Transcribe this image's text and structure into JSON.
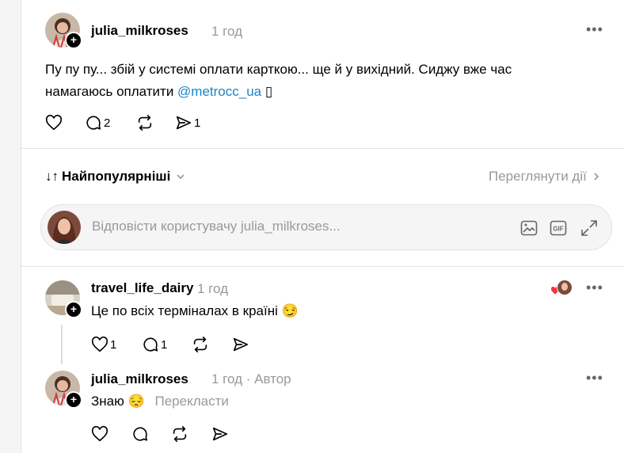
{
  "post": {
    "username": "julia_milkroses",
    "time": "1 год",
    "text": "Пу пу пу... збій у системі оплати карткою... ще й у вихідний. Сиджу вже час намагаюсь оплатити ",
    "mention": "@metrocc_ua",
    "trailing": " ▯",
    "replies_count": "2",
    "shares_count": "1"
  },
  "sort": {
    "label": "Найпопулярніші",
    "view_activity": "Переглянути дії"
  },
  "reply_box": {
    "placeholder": "Відповісти користувачу julia_milkroses..."
  },
  "comments": [
    {
      "username": "travel_life_dairy",
      "time": "1 год",
      "text": "Це по всіх терміналах в країні 😏",
      "likes": "1",
      "replies": "1"
    },
    {
      "username": "julia_milkroses",
      "time": "1 год",
      "author_label": "· Автор",
      "text": "Знаю 😔",
      "translate": "Перекласти"
    }
  ],
  "colors": {
    "mention": "#1b84c7",
    "heart": "#ff3040",
    "muted": "#999999"
  }
}
